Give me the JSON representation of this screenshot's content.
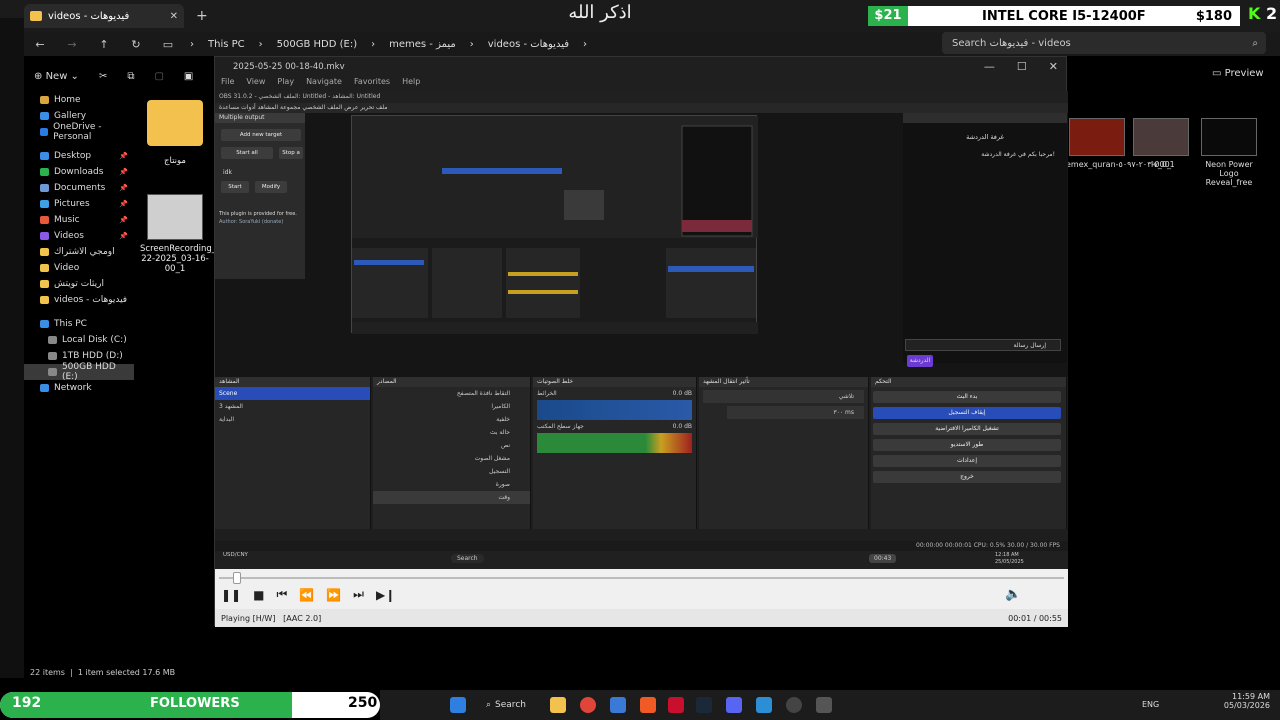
{
  "overlay": {
    "arabic_title": "اذكر الله",
    "price_left": "$21",
    "cpu_name": "INTEL CORE I5-12400F",
    "cpu_price": "$180",
    "kick_logo": "K",
    "kick_num": "2"
  },
  "explorer": {
    "tab_title": "videos - فيديوهات",
    "breadcrumbs": [
      "This PC",
      "500GB HDD (E:)",
      "memes - ميمز",
      "videos - فيديوهات"
    ],
    "search_placeholder": "Search فيديوهات - videos",
    "new_label": "New",
    "preview_label": "Preview",
    "sidebar": {
      "home": "Home",
      "gallery": "Gallery",
      "onedrive": "OneDrive - Personal",
      "desktop": "Desktop",
      "downloads": "Downloads",
      "documents": "Documents",
      "pictures": "Pictures",
      "music": "Music",
      "videos": "Videos",
      "f1": "اومجي الاشتراك",
      "f2": "Video",
      "f3": "اريثات تويتش",
      "f4": "videos - فيديوهات",
      "thispc": "This PC",
      "c": "Local Disk (C:)",
      "d": "1TB HDD (D:)",
      "e": "500GB HDD (E:)",
      "network": "Network"
    },
    "files": {
      "folder_name": "مونتاج",
      "recording_name": "ScreenRecording_07-22-2025_03-16-00_1"
    },
    "right_files": [
      "emex_quran-٢٠٣-٥٠٩٧-0001",
      "lv_0_",
      "Neon Power Logo Reveal_free"
    ],
    "status_items": "22 items",
    "status_selected": "1 item selected 17.6 MB"
  },
  "player": {
    "title": "2025-05-25 00-18-40.mkv",
    "menu": [
      "File",
      "View",
      "Play",
      "Navigate",
      "Favorites",
      "Help"
    ],
    "status_left": "Playing [H/W]",
    "status_audio": "[AAC 2.0]",
    "time": "00:01 / 00:55",
    "timestamp_overlay": "00:43"
  },
  "obs": {
    "titlebar": "OBS 31.0.2 - الملف الشخصي: Untitled - المشاهد: Untitled",
    "menu": "ملف  تحرير  عرض  الملف الشخصي  مجموعة المشاهد  أدوات  مساعدة",
    "multi_output": "Multiple output",
    "add_target": "Add new target",
    "start_all": "Start all",
    "stop_all": "Stop a",
    "idk": "idk",
    "start": "Start",
    "modify": "Modify",
    "plugin_note": "This plugin is provided for free.",
    "plugin_author": "Author: SoraYuki (donate)",
    "chat_title": "غرفة الدردشة",
    "chat_welcome": "مرحبا بكم في غرفة الدردشة!",
    "chat_send": "إرسال رسالة",
    "chat_tab": "الدردشة",
    "docks": {
      "scenes": "المشاهد",
      "sources": "المصادر",
      "mixer": "خلط الصوتيات",
      "transitions": "تأثير انتقال المشهد",
      "controls": "التحكم"
    },
    "scenes": [
      "Scene",
      "المشهد 3",
      "البداية"
    ],
    "sources": [
      "التقاط نافذة المتصفح",
      "الكاميرا",
      "خلفية",
      "حالة بث",
      "نص",
      "مشغل الصوت",
      "التسجيل",
      "صورة",
      "وقت"
    ],
    "mixer": [
      {
        "name": "الخرائط",
        "db": "0.0 dB"
      },
      {
        "name": "جهاز سطح المكتب",
        "db": "0.0 dB"
      }
    ],
    "transition_fade": "تلاشي",
    "transition_duration": "٣٠٠ ms",
    "control_buttons": [
      "بدء البث",
      "إيقاف التسجيل",
      "تشغيل الكاميرا الافتراضية",
      "طور الاستديو",
      "إعدادات",
      "خروج"
    ],
    "status": "00:00:00   00:00:01   CPU: 0.5%   30.00 / 30.00 FPS",
    "taskbar_search": "Search",
    "taskbar_time": "12:18 AM",
    "taskbar_date": "25/05/2025",
    "ticker": "USD/CNY"
  },
  "stream": {
    "followers_count": "192",
    "followers_label": "FOLLOWERS",
    "followers_goal": "250",
    "followers_progress": 0.768
  },
  "taskbar": {
    "search": "Search",
    "lang": "ENG",
    "time": "11:59 AM",
    "date": "05/03/2026"
  },
  "colors": {
    "green": "#2bb24c",
    "kick": "#53fc18",
    "obs_blue": "#284cb8",
    "folder": "#f2c14e"
  }
}
